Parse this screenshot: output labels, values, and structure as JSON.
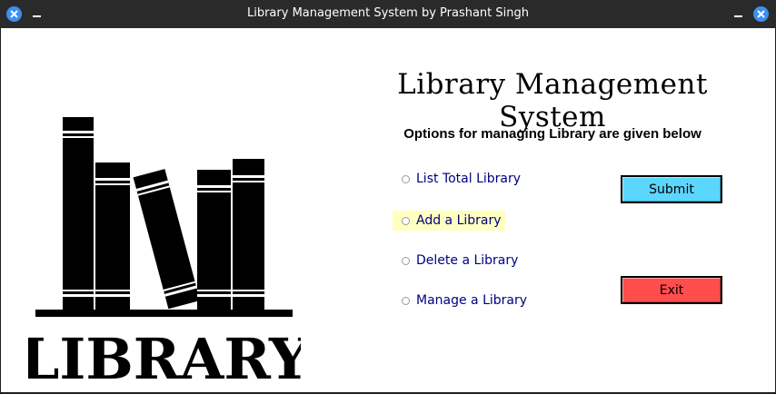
{
  "window": {
    "title": "Library Management System by Prashant Singh"
  },
  "app": {
    "title": "Library Management System",
    "subtitle": "Options for managing Library are given below"
  },
  "logo": {
    "text": "LIBRARY"
  },
  "options": [
    {
      "label": "List Total Library",
      "highlighted": false
    },
    {
      "label": "Add a Library",
      "highlighted": true
    },
    {
      "label": "Delete a Library",
      "highlighted": false
    },
    {
      "label": "Manage a Library",
      "highlighted": false
    }
  ],
  "buttons": {
    "submit_label": "Submit",
    "exit_label": "Exit"
  },
  "colors": {
    "submit": "#5bd6ff",
    "exit": "#ff4d4d",
    "highlight": "#ffffc0",
    "titlebar": "#2a2a2a"
  }
}
